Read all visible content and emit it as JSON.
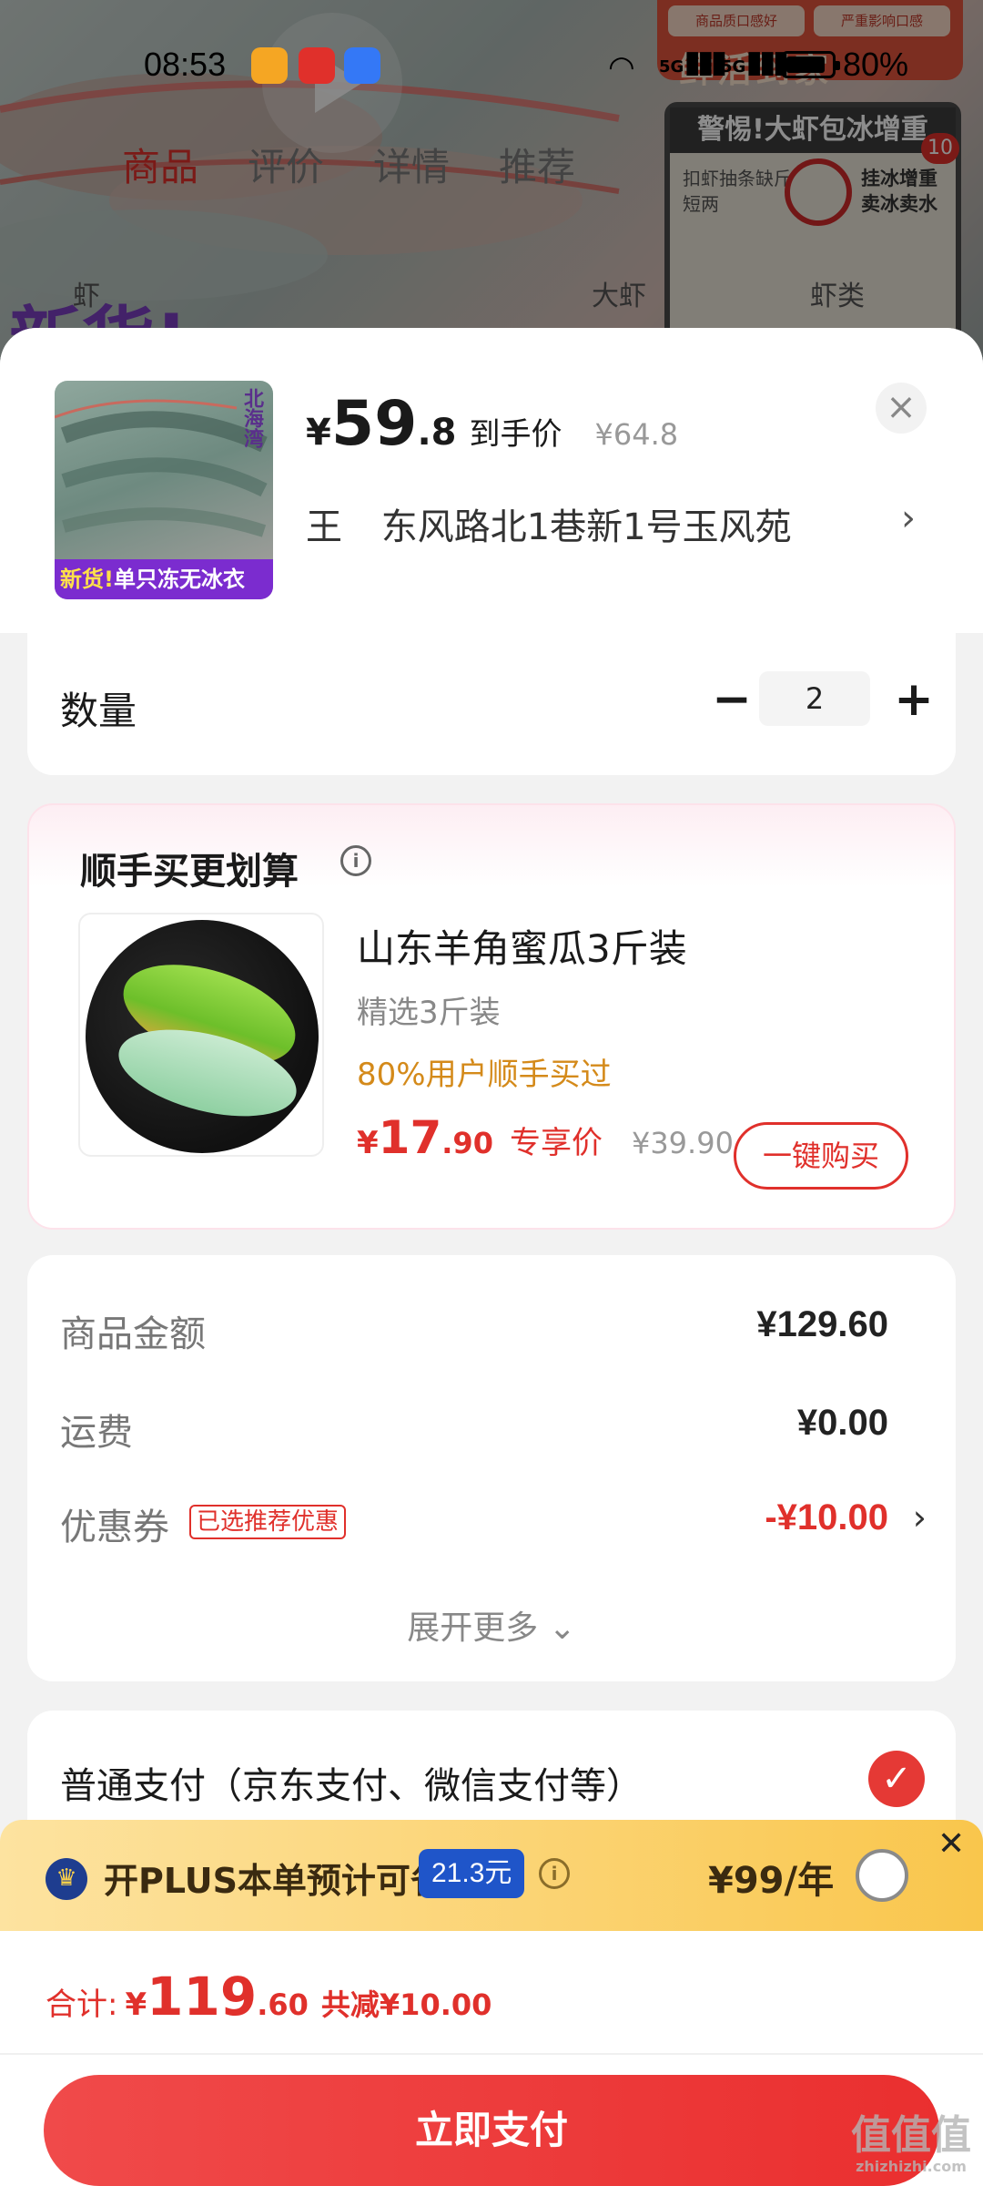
{
  "status_bar": {
    "time": "08:53",
    "network_1": "5G",
    "network_2": "5G",
    "battery": "80%"
  },
  "background_page": {
    "tabs": [
      "商品",
      "评价",
      "详情",
      "推荐"
    ],
    "active_tab": 0,
    "promo_top": [
      "商品质口感好",
      "严重影响口感",
      "鲜活到家"
    ],
    "promo_title": "警惕!大虾包冰增重",
    "promo_left": "扣虾抽条缺斤短两",
    "promo_right": "挂冰增重卖冰卖水",
    "promo_badge": "10",
    "search_words": [
      "虾",
      "大虾",
      "虾类"
    ],
    "banner_text": "新货!"
  },
  "product": {
    "thumb_brand": "北海湾",
    "thumb_tag_new": "新货!",
    "thumb_tag_rest": "单只冻无冰衣",
    "price_currency": "¥",
    "price_int": "59",
    "price_dec": ".8",
    "price_label": "到手价",
    "original_price": "¥64.8",
    "close_icon": "×",
    "recipient": "王",
    "address": "东风路北1巷新1号玉风苑",
    "chevron": "›"
  },
  "quantity": {
    "label": "数量",
    "minus": "−",
    "value": "2",
    "plus": "+"
  },
  "upsell": {
    "title": "顺手买更划算",
    "info_icon": "i",
    "name": "山东羊角蜜瓜3斤装",
    "spec": "精选3斤装",
    "social_proof": "80%用户顺手买过",
    "price_currency": "¥",
    "price_int": "17",
    "price_dec": ".90",
    "price_label": "专享价",
    "original_price": "¥39.90",
    "buy_button": "一键购买"
  },
  "summary": {
    "amount_label": "商品金额",
    "amount_value": "¥129.60",
    "shipping_label": "运费",
    "shipping_value": "¥0.00",
    "coupon_label": "优惠券",
    "coupon_badge": "已选推荐优惠",
    "coupon_value": "-¥10.00",
    "coupon_chevron": "›",
    "expand_more": "展开更多 ⌄"
  },
  "payment": {
    "method_label": "普通支付（京东支付、微信支付等）",
    "selected_icon": "✓"
  },
  "plus_banner": {
    "crown_icon": "♛",
    "text": "开PLUS本单预计可省",
    "save_amount": "21.3元",
    "info_icon": "i",
    "price": "¥99/年",
    "close_icon": "✕"
  },
  "bottom_bar": {
    "total_label": "合计:",
    "total_currency": "¥",
    "total_int": "119",
    "total_dec": ".60",
    "discount_text": "共减¥10.00",
    "pay_button": "立即支付"
  },
  "watermark": {
    "main": "值值值",
    "sub": "zhizhizhi.com"
  },
  "colors": {
    "accent_red": "#e0302b",
    "pay_button": "#ea2f2f",
    "coupon_orange": "#d48a1a",
    "plus_gold": "#fbd26f",
    "plus_blue": "#1f55c9"
  }
}
